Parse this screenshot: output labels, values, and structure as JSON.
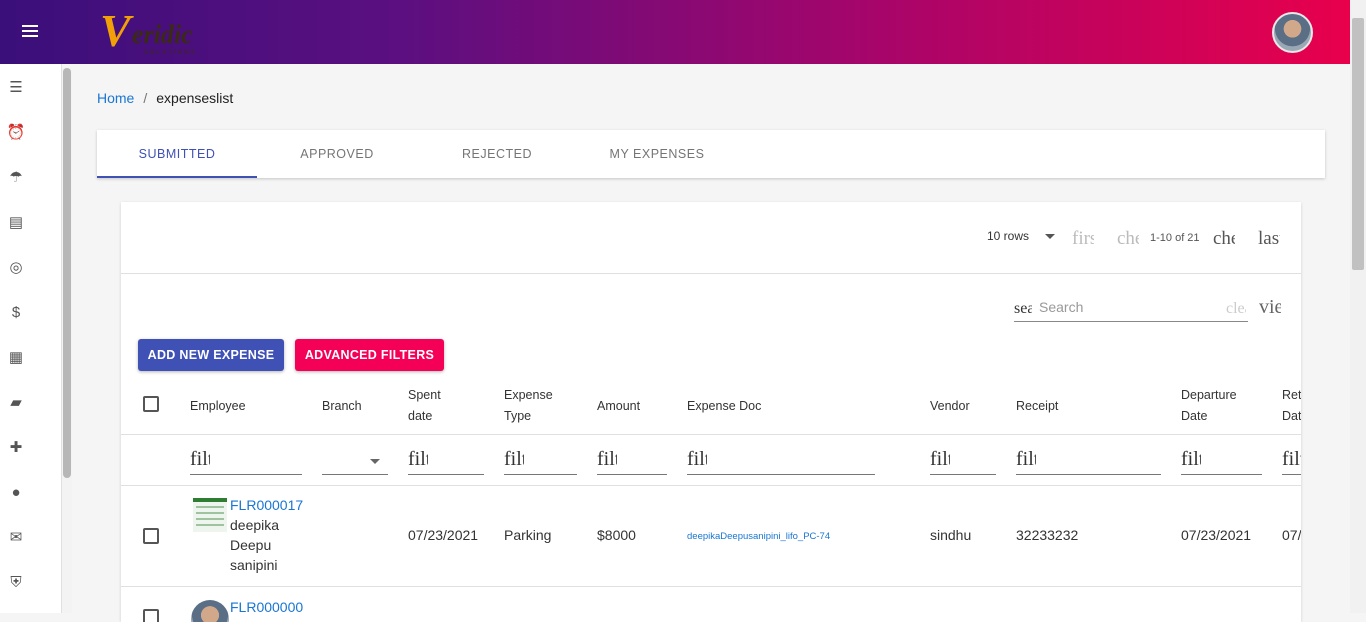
{
  "topbar": {
    "logo": {
      "v": "V",
      "rest": "eridic",
      "sub": "SOLUTIONS"
    }
  },
  "sidebar": {
    "items": [
      {
        "icon": "checklist-icon"
      },
      {
        "icon": "alarm-icon"
      },
      {
        "icon": "umbrella-icon"
      },
      {
        "icon": "document-icon"
      },
      {
        "icon": "coins-icon"
      },
      {
        "icon": "dollar-icon"
      },
      {
        "icon": "receipt-icon"
      },
      {
        "icon": "chat-icon"
      },
      {
        "icon": "add-user-icon"
      },
      {
        "icon": "group-icon"
      },
      {
        "icon": "mail-icon"
      },
      {
        "icon": "shield-check-icon"
      }
    ]
  },
  "breadcrumb": {
    "home": "Home",
    "separator": "/",
    "current": "expenseslist"
  },
  "tabs": [
    {
      "label": "SUBMITTED",
      "active": true
    },
    {
      "label": "APPROVED",
      "active": false
    },
    {
      "label": "REJECTED",
      "active": false
    },
    {
      "label": "MY EXPENSES",
      "active": false
    }
  ],
  "pager": {
    "rows_label": "10 rows",
    "first_icon": "first_page",
    "prev_icon": "chevron_left",
    "count": "1-10 of 21",
    "next_icon": "chevron_right",
    "last_icon": "last_page"
  },
  "search": {
    "prefix_icon": "search",
    "placeholder": "Search",
    "clear_icon": "clear",
    "view_icon": "view_column"
  },
  "buttons": {
    "add": "ADD NEW EXPENSE",
    "filters": "ADVANCED FILTERS"
  },
  "table": {
    "headers": {
      "employee": "Employee",
      "branch": "Branch",
      "spent_date_1": "Spent",
      "spent_date_2": "date",
      "expense_type_1": "Expense",
      "expense_type_2": "Type",
      "amount": "Amount",
      "expense_doc": "Expense Doc",
      "vendor": "Vendor",
      "receipt": "Receipt",
      "departure_1": "Departure",
      "departure_2": "Date",
      "return_1": "Ret",
      "return_2": "Dat"
    },
    "filter_placeholder": "filter_list",
    "rows": [
      {
        "id": "FLR000017",
        "name_1": "deepika",
        "name_2": "Deepu",
        "name_3": "sanipini",
        "spent_date": "07/23/2021",
        "expense_type": "Parking",
        "amount": "$8000",
        "expense_doc": "deepikaDeepusanipini_lifo_PC-74",
        "vendor": "sindhu",
        "receipt": "32233232",
        "departure_date": "07/23/2021",
        "return_date": "07/"
      },
      {
        "id": "FLR000000"
      }
    ]
  },
  "colors": {
    "primary": "#3f51b5",
    "accent": "#f50057",
    "link": "#1976d2"
  }
}
